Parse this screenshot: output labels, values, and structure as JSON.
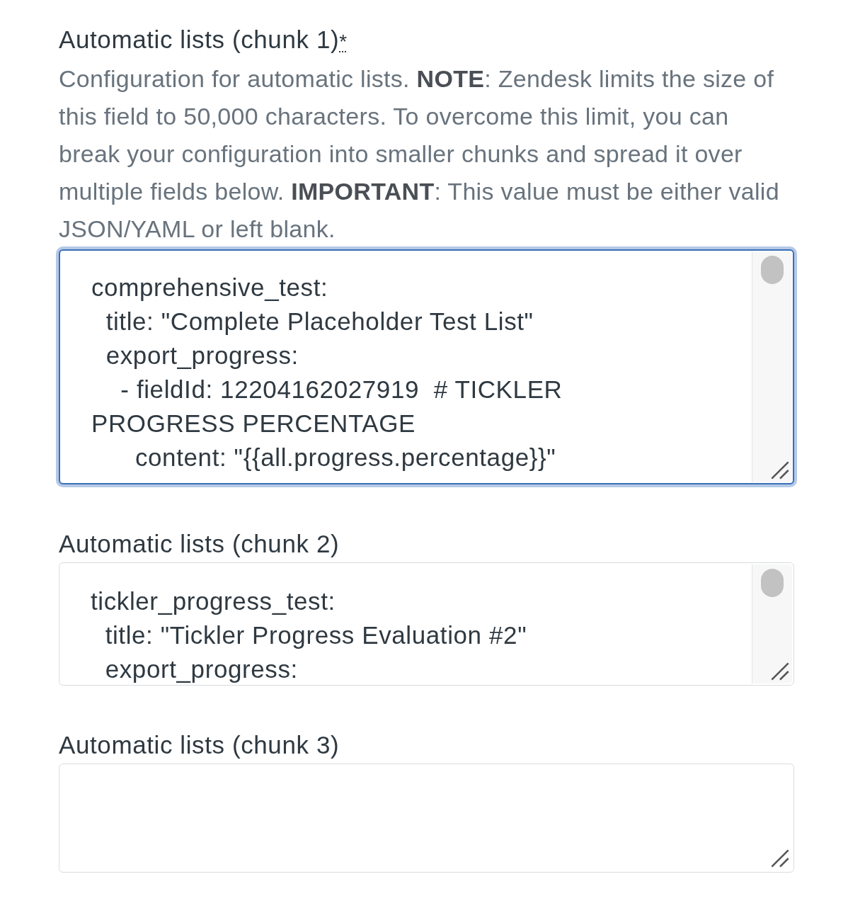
{
  "fields": [
    {
      "label": "Automatic lists (chunk 1)",
      "required_mark": "*",
      "description": "Configuration for automatic lists. **NOTE**: Zendesk limits the size of this field to 50,000 characters. To overcome this limit, you can break your configuration into smaller chunks and spread it over multiple fields below. **IMPORTANT**: This value must be either valid JSON/YAML or left blank.",
      "focused": true,
      "value_lines": [
        "comprehensive_test:",
        "  title: \"Complete Placeholder Test List\"",
        "  export_progress:",
        "    - fieldId: 12204162027919  # TICKLER",
        "PROGRESS PERCENTAGE",
        "      content: \"{{all.progress.percentage}}\""
      ]
    },
    {
      "label": "Automatic lists (chunk 2)",
      "focused": false,
      "value_lines": [
        "tickler_progress_test:",
        "  title: \"Tickler Progress Evaluation #2\"",
        "  export_progress:"
      ]
    },
    {
      "label": "Automatic lists (chunk 3)",
      "focused": false
    }
  ]
}
